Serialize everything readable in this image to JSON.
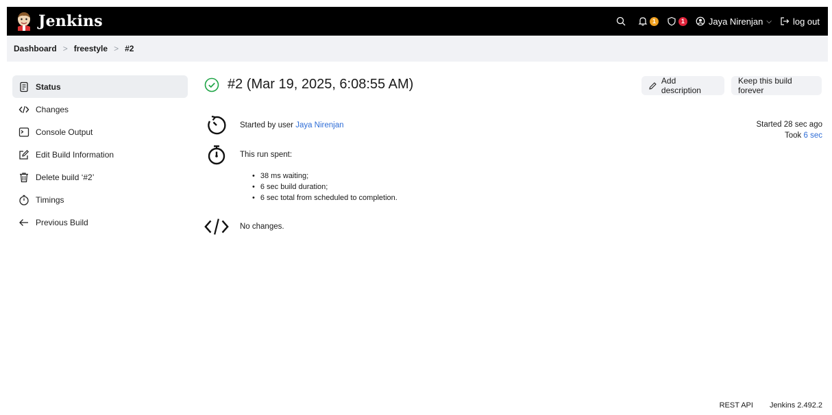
{
  "header": {
    "brand": "Jenkins",
    "notifications_count": "1",
    "security_count": "1",
    "user": "Jaya Nirenjan",
    "logout": "log out"
  },
  "breadcrumb": [
    "Dashboard",
    "freestyle",
    "#2"
  ],
  "sidebar": {
    "items": [
      {
        "label": "Status",
        "icon": "document-icon"
      },
      {
        "label": "Changes",
        "icon": "code-icon"
      },
      {
        "label": "Console Output",
        "icon": "terminal-icon"
      },
      {
        "label": "Edit Build Information",
        "icon": "edit-icon"
      },
      {
        "label": "Delete build ‘#2’",
        "icon": "trash-icon"
      },
      {
        "label": "Timings",
        "icon": "timer-icon"
      },
      {
        "label": "Previous Build",
        "icon": "arrow-left-icon"
      }
    ]
  },
  "main": {
    "title": "#2 (Mar 19, 2025, 6:08:55 AM)",
    "add_description": "Add description",
    "keep_forever": "Keep this build forever",
    "started_by_prefix": "Started by user",
    "started_by_user": "Jaya Nirenjan",
    "run_spent": "This run spent:",
    "spent_items": [
      "38 ms waiting;",
      "6 sec build duration;",
      "6 sec total from scheduled to completion."
    ],
    "no_changes": "No changes.",
    "started_ago": "Started 28 sec ago",
    "took_prefix": "Took",
    "took_value": "6 sec"
  },
  "footer": {
    "rest_api": "REST API",
    "version": "Jenkins 2.492.2"
  },
  "colors": {
    "success": "#1ea446",
    "link": "#2d6cd6",
    "badge_notify": "#f0a020",
    "badge_security": "#e0243b"
  }
}
